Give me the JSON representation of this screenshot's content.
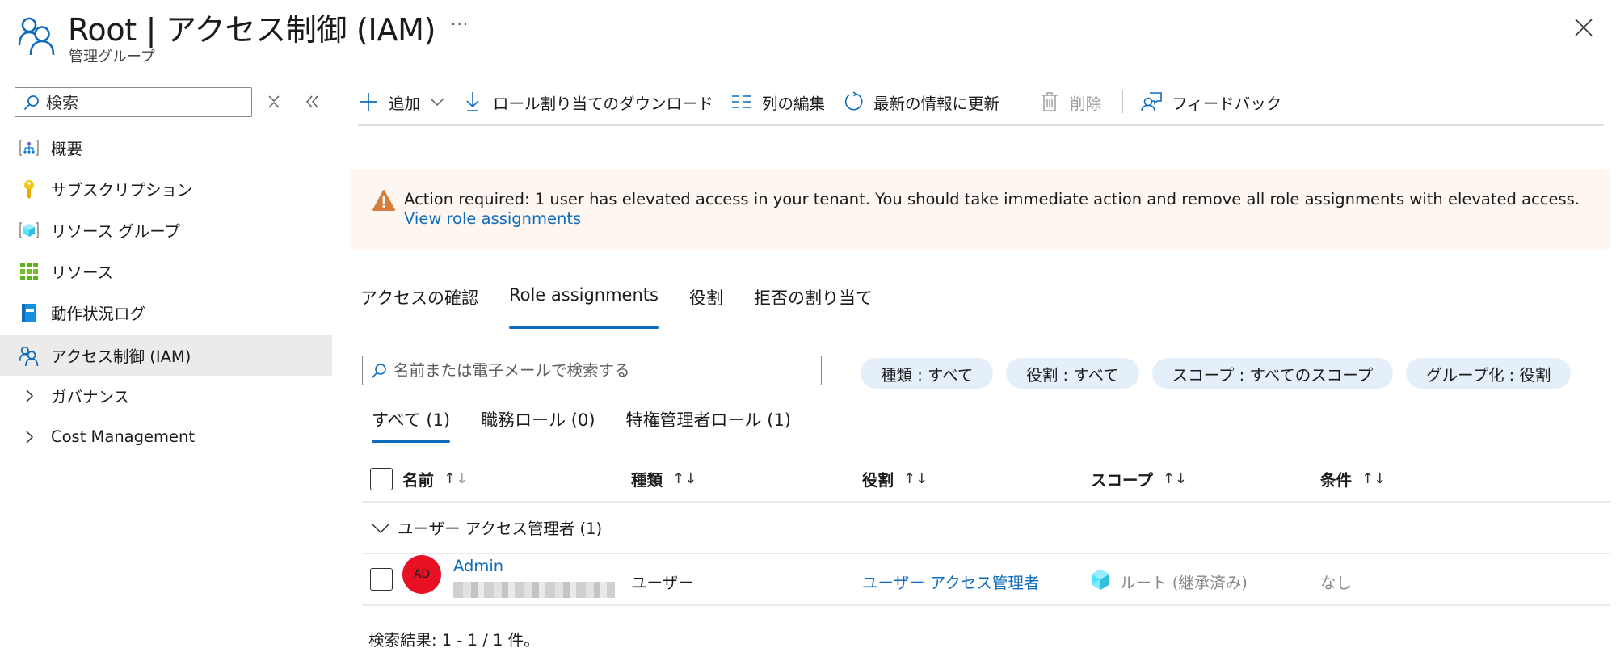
{
  "header": {
    "title": "Root | アクセス制御 (IAM)",
    "subtitle": "管理グループ",
    "more_label": "···",
    "icon": "people-icon",
    "close_icon": "close-icon"
  },
  "sidebar": {
    "search": {
      "placeholder": "検索",
      "value": ""
    },
    "clear_icon": "clear-filter-icon",
    "collapse_icon": "double-chevron-left-icon",
    "items": [
      {
        "label": "概要",
        "icon": "management-group-icon",
        "selected": false
      },
      {
        "label": "サブスクリプション",
        "icon": "key-icon",
        "selected": false
      },
      {
        "label": "リソース グループ",
        "icon": "resource-group-icon",
        "selected": false
      },
      {
        "label": "リソース",
        "icon": "grid-icon",
        "selected": false
      },
      {
        "label": "動作状況ログ",
        "icon": "activity-log-icon",
        "selected": false
      },
      {
        "label": "アクセス制御 (IAM)",
        "icon": "people-icon",
        "selected": true
      },
      {
        "label": "ガバナンス",
        "icon": "chevron-right-icon",
        "expandable": true
      },
      {
        "label": "Cost Management",
        "icon": "chevron-right-icon",
        "expandable": true
      }
    ]
  },
  "toolbar": {
    "add": "追加",
    "download": "ロール割り当てのダウンロード",
    "edit_columns": "列の編集",
    "refresh": "最新の情報に更新",
    "delete": "削除",
    "feedback": "フィードバック"
  },
  "banner": {
    "text": "Action required: 1 user has elevated access in your tenant. You should take immediate action and remove all role assignments with elevated access. ",
    "link": "View role assignments",
    "severity": "warning",
    "bg_color": "#fdf6f1",
    "icon_color": "#d67f3c"
  },
  "tabs": [
    {
      "label": "アクセスの確認",
      "active": false
    },
    {
      "label": "Role assignments",
      "active": true
    },
    {
      "label": "役割",
      "active": false
    },
    {
      "label": "拒否の割り当て",
      "active": false
    }
  ],
  "search": {
    "placeholder": "名前または電子メールで検索する",
    "value": ""
  },
  "filters": [
    "種類 : すべて",
    "役割 : すべて",
    "スコープ : すべてのスコープ",
    "グループ化 : 役割"
  ],
  "subtabs": [
    {
      "label": "すべて (1)",
      "active": true
    },
    {
      "label": "職務ロール (0)",
      "active": false
    },
    {
      "label": "特権管理者ロール (1)",
      "active": false
    }
  ],
  "table": {
    "columns": [
      "名前",
      "種類",
      "役割",
      "スコープ",
      "条件"
    ],
    "sort_glyph": "↑↓",
    "group": {
      "label": "ユーザー アクセス管理者 (1)",
      "expanded": true
    },
    "rows": [
      {
        "avatar_initials": "AD",
        "avatar_color": "#e81123",
        "name": "Admin",
        "email_redacted": true,
        "type": "ユーザー",
        "role": "ユーザー アクセス管理者",
        "scope": "ルート (継承済み)",
        "condition": "なし"
      }
    ]
  },
  "footer": {
    "results": "検索結果: 1 - 1 / 1 件。"
  },
  "colors": {
    "accent": "#0f6cbd",
    "selected_bg": "#edebe9",
    "pill_bg": "#e4eff9"
  }
}
